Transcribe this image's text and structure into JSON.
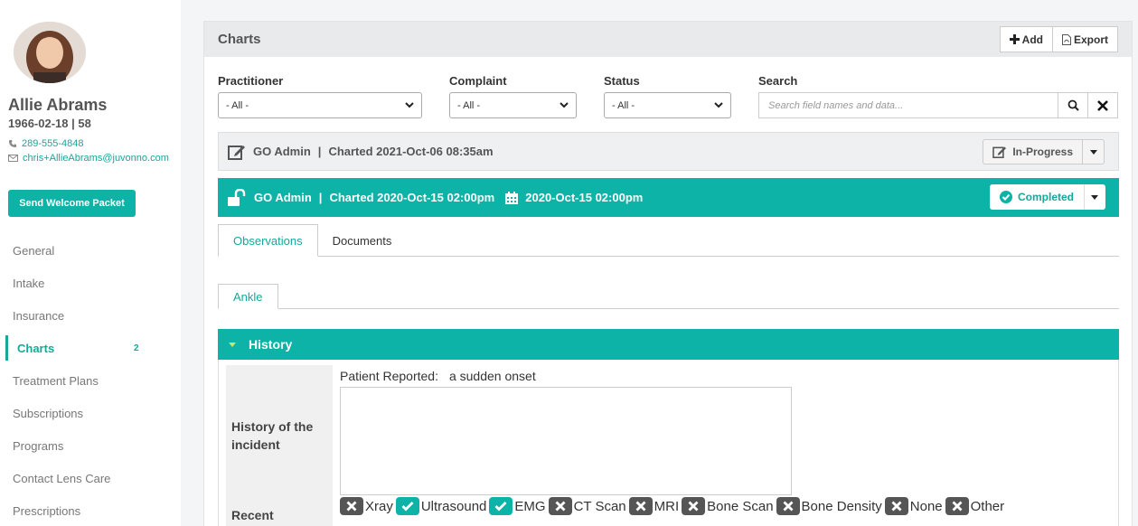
{
  "patient": {
    "name": "Allie Abrams",
    "dob_age": "1966-02-18  |  58",
    "phone": "289-555-4848",
    "email": "chris+AllieAbrams@juvonno.com",
    "welcome_button": "Send Welcome Packet"
  },
  "sidebar": {
    "items": [
      {
        "label": "General"
      },
      {
        "label": "Intake"
      },
      {
        "label": "Insurance"
      },
      {
        "label": "Charts",
        "badge": "2",
        "active": true
      },
      {
        "label": "Treatment Plans"
      },
      {
        "label": "Subscriptions"
      },
      {
        "label": "Programs"
      },
      {
        "label": "Contact Lens Care"
      },
      {
        "label": "Prescriptions"
      }
    ]
  },
  "panel": {
    "title": "Charts",
    "add_label": "Add",
    "export_label": "Export"
  },
  "filters": {
    "practitioner_label": "Practitioner",
    "practitioner_value": "- All -",
    "complaint_label": "Complaint",
    "complaint_value": "- All -",
    "status_label": "Status",
    "status_value": "- All -",
    "search_label": "Search",
    "search_placeholder": "Search field names and data..."
  },
  "charts": [
    {
      "author": "GO Admin",
      "charted": "Charted 2021-Oct-06 08:35am",
      "status": "In-Progress"
    },
    {
      "author": "GO Admin",
      "charted": "Charted 2020-Oct-15 02:00pm",
      "date": "2020-Oct-15 02:00pm",
      "status": "Completed"
    }
  ],
  "tabs": [
    "Observations",
    "Documents"
  ],
  "subtabs": [
    "Ankle"
  ],
  "section": {
    "title": "History",
    "history_label": "History of the incident",
    "patient_reported_label": "Patient Reported:",
    "patient_reported_value": "a sudden onset",
    "recent_label": "Recent Investigations",
    "investigations": [
      {
        "label": "Xray",
        "checked": false
      },
      {
        "label": "Ultrasound",
        "checked": true
      },
      {
        "label": "EMG",
        "checked": true
      },
      {
        "label": "CT Scan",
        "checked": false
      },
      {
        "label": "MRI",
        "checked": false
      },
      {
        "label": "Bone Scan",
        "checked": false
      },
      {
        "label": "Bone Density",
        "checked": false
      },
      {
        "label": "None",
        "checked": false
      },
      {
        "label": "Other",
        "checked": false
      }
    ]
  },
  "colors": {
    "accent": "#0cb3a6",
    "link": "#16a89a"
  }
}
